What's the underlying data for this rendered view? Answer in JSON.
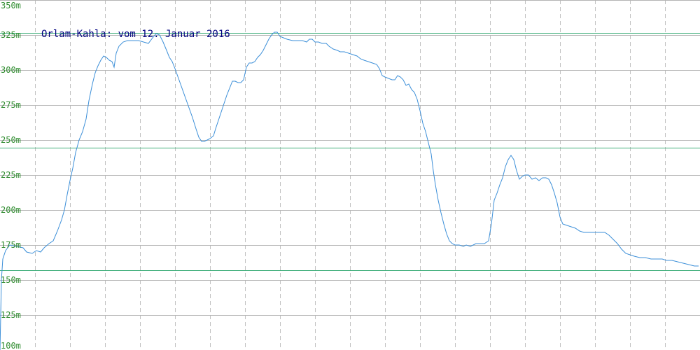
{
  "chart_data": {
    "type": "line",
    "title": "Orlam-Kahla: vom 12. Januar 2016",
    "xlabel": "",
    "ylabel": "",
    "ylim": [
      100,
      350
    ],
    "y_ticks": [
      100,
      125,
      150,
      175,
      200,
      225,
      250,
      275,
      300,
      325,
      350
    ],
    "y_tick_labels": [
      "100m",
      "125m",
      "150m",
      "175m",
      "200m",
      "225m",
      "250m",
      "275m",
      "300m",
      "325m",
      "350m"
    ],
    "x_range": [
      0,
      1000
    ],
    "grid": true,
    "reference_lines": [
      326.5,
      244.5,
      157
    ],
    "colors": {
      "line": "#3c8fd8",
      "reference": "#3fae7a",
      "grid_h": "#b4b4b4",
      "grid_v": "#c0c0c0",
      "tick": "#2e8b2e",
      "title": "#00007f"
    },
    "series": [
      {
        "points": [
          [
            0,
            100
          ],
          [
            2,
            150
          ],
          [
            4,
            165
          ],
          [
            8,
            171
          ],
          [
            14,
            175
          ],
          [
            24,
            174
          ],
          [
            33,
            173
          ],
          [
            38,
            170
          ],
          [
            46,
            169
          ],
          [
            52,
            171
          ],
          [
            58,
            170
          ],
          [
            63,
            173
          ],
          [
            70,
            176
          ],
          [
            76,
            178
          ],
          [
            82,
            185
          ],
          [
            88,
            193
          ],
          [
            92,
            200
          ],
          [
            96,
            211
          ],
          [
            100,
            221
          ],
          [
            104,
            230
          ],
          [
            108,
            241
          ],
          [
            113,
            250
          ],
          [
            118,
            256
          ],
          [
            123,
            265
          ],
          [
            127,
            278
          ],
          [
            132,
            290
          ],
          [
            136,
            298
          ],
          [
            140,
            303
          ],
          [
            144,
            307
          ],
          [
            148,
            310
          ],
          [
            152,
            309
          ],
          [
            156,
            307
          ],
          [
            160,
            306
          ],
          [
            163,
            302
          ],
          [
            166,
            312
          ],
          [
            170,
            317
          ],
          [
            176,
            320
          ],
          [
            182,
            321
          ],
          [
            190,
            321
          ],
          [
            198,
            321
          ],
          [
            205,
            320
          ],
          [
            212,
            319
          ],
          [
            218,
            323
          ],
          [
            223,
            326
          ],
          [
            228,
            325
          ],
          [
            233,
            320
          ],
          [
            238,
            314
          ],
          [
            242,
            309
          ],
          [
            246,
            306
          ],
          [
            250,
            301
          ],
          [
            255,
            294
          ],
          [
            260,
            287
          ],
          [
            265,
            280
          ],
          [
            270,
            273
          ],
          [
            275,
            266
          ],
          [
            280,
            258
          ],
          [
            284,
            252
          ],
          [
            288,
            249
          ],
          [
            292,
            249
          ],
          [
            296,
            250
          ],
          [
            300,
            251
          ],
          [
            305,
            253
          ],
          [
            308,
            258
          ],
          [
            312,
            264
          ],
          [
            316,
            270
          ],
          [
            320,
            276
          ],
          [
            324,
            282
          ],
          [
            328,
            287
          ],
          [
            332,
            292
          ],
          [
            336,
            292
          ],
          [
            340,
            291
          ],
          [
            344,
            291
          ],
          [
            348,
            293
          ],
          [
            352,
            302
          ],
          [
            356,
            305
          ],
          [
            360,
            305
          ],
          [
            364,
            306
          ],
          [
            368,
            309
          ],
          [
            372,
            311
          ],
          [
            376,
            314
          ],
          [
            380,
            318
          ],
          [
            384,
            322
          ],
          [
            388,
            325
          ],
          [
            392,
            327
          ],
          [
            396,
            327
          ],
          [
            400,
            324
          ],
          [
            405,
            323
          ],
          [
            410,
            322
          ],
          [
            418,
            321
          ],
          [
            425,
            321
          ],
          [
            432,
            321
          ],
          [
            438,
            320
          ],
          [
            442,
            322
          ],
          [
            446,
            322
          ],
          [
            450,
            320
          ],
          [
            455,
            320
          ],
          [
            460,
            319
          ],
          [
            466,
            319
          ],
          [
            470,
            317
          ],
          [
            476,
            315
          ],
          [
            482,
            314
          ],
          [
            486,
            313
          ],
          [
            492,
            313
          ],
          [
            498,
            312
          ],
          [
            504,
            311
          ],
          [
            510,
            310
          ],
          [
            515,
            308
          ],
          [
            520,
            307
          ],
          [
            526,
            306
          ],
          [
            532,
            305
          ],
          [
            538,
            304
          ],
          [
            542,
            301
          ],
          [
            546,
            296
          ],
          [
            550,
            295
          ],
          [
            555,
            294
          ],
          [
            560,
            293
          ],
          [
            564,
            293
          ],
          [
            568,
            296
          ],
          [
            572,
            295
          ],
          [
            576,
            293
          ],
          [
            580,
            289
          ],
          [
            584,
            290
          ],
          [
            588,
            286
          ],
          [
            592,
            284
          ],
          [
            596,
            279
          ],
          [
            600,
            271
          ],
          [
            604,
            262
          ],
          [
            608,
            256
          ],
          [
            612,
            248
          ],
          [
            616,
            240
          ],
          [
            619,
            228
          ],
          [
            622,
            218
          ],
          [
            626,
            207
          ],
          [
            630,
            198
          ],
          [
            634,
            190
          ],
          [
            638,
            183
          ],
          [
            642,
            178
          ],
          [
            646,
            176
          ],
          [
            650,
            175
          ],
          [
            656,
            175
          ],
          [
            662,
            174
          ],
          [
            666,
            175
          ],
          [
            672,
            174
          ],
          [
            676,
            175
          ],
          [
            680,
            176
          ],
          [
            686,
            176
          ],
          [
            692,
            176
          ],
          [
            698,
            178
          ],
          [
            702,
            190
          ],
          [
            706,
            207
          ],
          [
            710,
            212
          ],
          [
            714,
            218
          ],
          [
            718,
            223
          ],
          [
            722,
            231
          ],
          [
            726,
            236
          ],
          [
            730,
            239
          ],
          [
            734,
            236
          ],
          [
            738,
            228
          ],
          [
            742,
            222
          ],
          [
            746,
            224
          ],
          [
            750,
            225
          ],
          [
            755,
            225
          ],
          [
            760,
            222
          ],
          [
            765,
            223
          ],
          [
            770,
            221
          ],
          [
            775,
            223
          ],
          [
            780,
            223
          ],
          [
            784,
            222
          ],
          [
            788,
            218
          ],
          [
            792,
            212
          ],
          [
            796,
            205
          ],
          [
            800,
            195
          ],
          [
            804,
            190
          ],
          [
            810,
            189
          ],
          [
            816,
            188
          ],
          [
            822,
            187
          ],
          [
            828,
            185
          ],
          [
            834,
            184
          ],
          [
            840,
            184
          ],
          [
            848,
            184
          ],
          [
            856,
            184
          ],
          [
            864,
            184
          ],
          [
            870,
            182
          ],
          [
            876,
            179
          ],
          [
            882,
            176
          ],
          [
            888,
            172
          ],
          [
            894,
            169
          ],
          [
            900,
            168
          ],
          [
            906,
            167
          ],
          [
            914,
            166
          ],
          [
            922,
            166
          ],
          [
            930,
            165
          ],
          [
            938,
            165
          ],
          [
            946,
            165
          ],
          [
            952,
            164
          ],
          [
            960,
            164
          ],
          [
            968,
            163
          ],
          [
            976,
            162
          ],
          [
            984,
            161
          ],
          [
            992,
            160
          ],
          [
            998,
            160
          ]
        ]
      }
    ]
  }
}
